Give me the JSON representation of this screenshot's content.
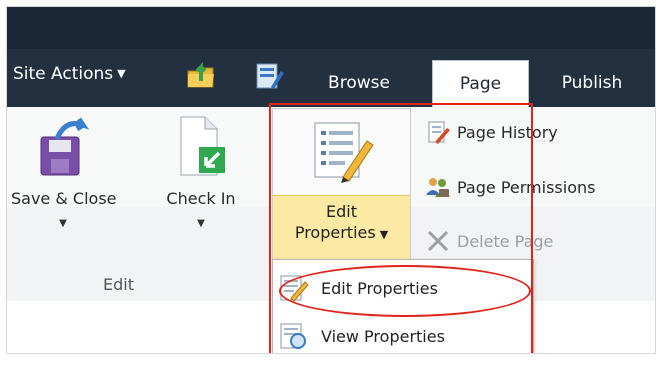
{
  "topbar": {
    "site_actions_label": "Site Actions",
    "tabs": [
      {
        "label": "Browse"
      },
      {
        "label": "Page"
      },
      {
        "label": "Publish"
      }
    ]
  },
  "ribbon": {
    "edit_group": {
      "save_close_label": "Save & Close",
      "check_in_label": "Check In",
      "group_label": "Edit"
    },
    "edit_properties": {
      "line1": "Edit",
      "line2": "Properties"
    },
    "small_commands": [
      {
        "label": "Page History"
      },
      {
        "label": "Page Permissions"
      },
      {
        "label": "Delete Page"
      }
    ]
  },
  "dropdown_menu": {
    "items": [
      {
        "label": "Edit Properties"
      },
      {
        "label": "View Properties"
      }
    ]
  },
  "colors": {
    "topbar": "#1c2838",
    "highlight_yellow": "#fbe9a4",
    "annotation_red": "#e0241c"
  }
}
